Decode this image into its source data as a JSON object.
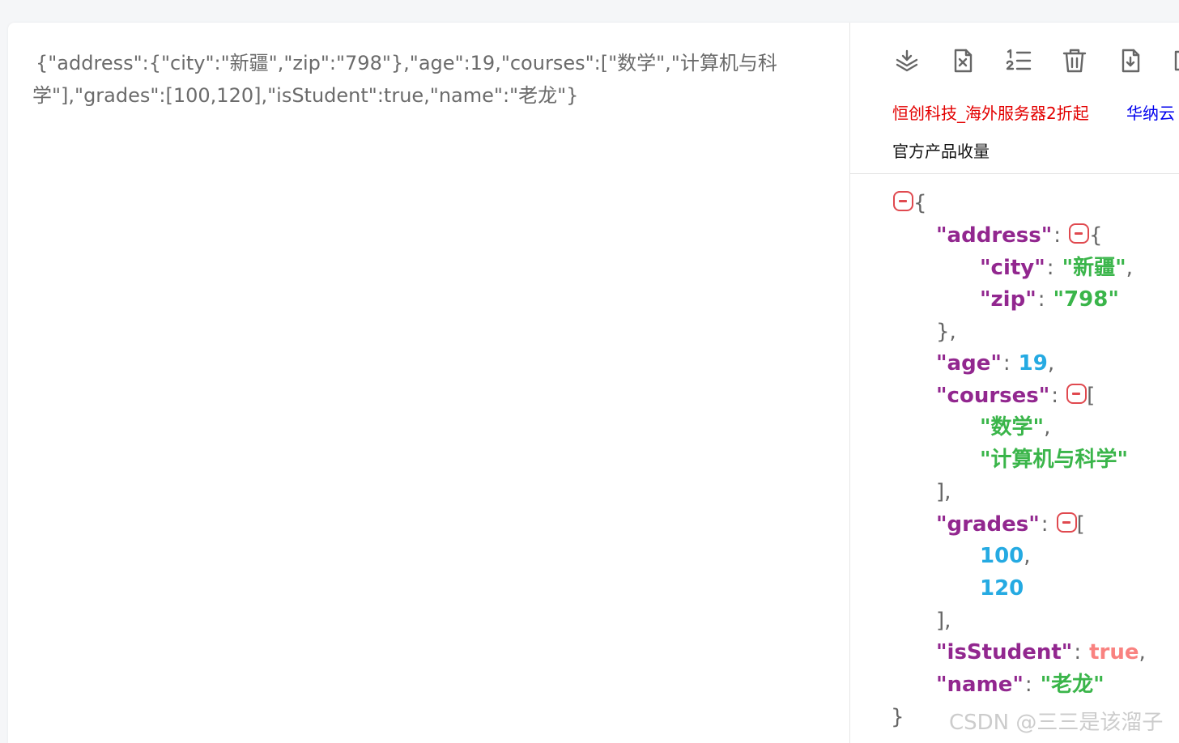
{
  "input": {
    "raw_json": "{\"address\":{\"city\":\"新疆\",\"zip\":\"798\"},\"age\":19,\"courses\":[\"数学\",\"计算机与科学\"],\"grades\":[100,120],\"isStudent\":true,\"name\":\"老龙\"}"
  },
  "toolbar": {
    "icons": [
      "compress-download-icon",
      "clear-file-icon",
      "ordered-list-icon",
      "trash-icon",
      "file-download-icon",
      "copy-icon"
    ]
  },
  "ads": {
    "red_link": "恒创科技_海外服务器2折起",
    "blue_link": "华纳云"
  },
  "official_link": "官方产品收量",
  "tree": {
    "open_brace": "{",
    "close_brace": "}",
    "address_key": "\"address\"",
    "address_open": "{",
    "city_key": "\"city\"",
    "city_val": "\"新疆\"",
    "zip_key": "\"zip\"",
    "zip_val": "\"798\"",
    "address_close": "},",
    "age_key": "\"age\"",
    "age_val": "19",
    "courses_key": "\"courses\"",
    "courses_open": "[",
    "course_0": "\"数学\"",
    "course_1": "\"计算机与科学\"",
    "courses_close": "],",
    "grades_key": "\"grades\"",
    "grades_open": "[",
    "grade_0": "100",
    "grade_1": "120",
    "grades_close": "],",
    "isStudent_key": "\"isStudent\"",
    "isStudent_val": "true",
    "name_key": "\"name\"",
    "name_val": "\"老龙\"",
    "colon": ":",
    "comma": ","
  },
  "watermark": "CSDN @三三是该溜子",
  "colors": {
    "key": "#92278f",
    "string": "#3ab54a",
    "number": "#25aae2",
    "boolean": "#f98280",
    "toggle": "#e0494f",
    "ad_red": "#e30000",
    "ad_blue": "#0000ee"
  }
}
